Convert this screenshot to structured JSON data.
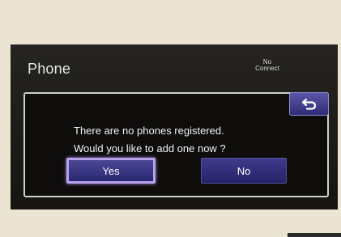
{
  "screen": {
    "title": "Phone",
    "connect_status": [
      "No",
      "Connect"
    ]
  },
  "dialog": {
    "message_lines": [
      "There are no phones registered.",
      "Would you like to add one now ?"
    ],
    "yes_label": "Yes",
    "no_label": "No",
    "back_icon": "back-arrow-icon"
  },
  "colors": {
    "background": "#ebe4d3",
    "screen": "#1d1b18",
    "button": "#2f2c78",
    "selected_outline": "#b8a3ea"
  }
}
